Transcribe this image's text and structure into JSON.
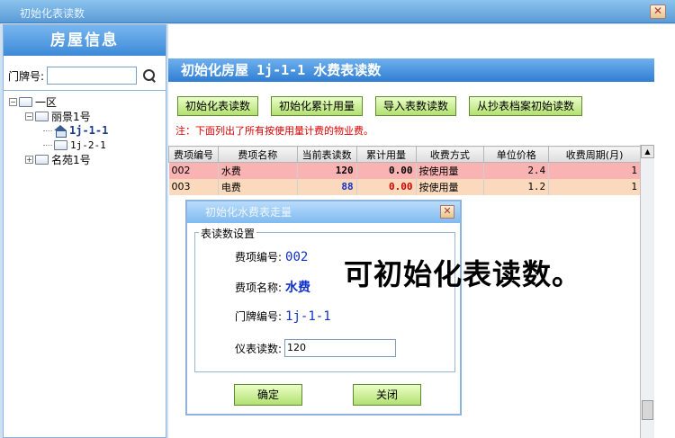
{
  "window": {
    "title": "初始化表读数",
    "close_label": "✕"
  },
  "left_panel": {
    "header": "房屋信息",
    "door_label": "门牌号:",
    "door_value": "",
    "tree": [
      {
        "label": "一区",
        "toggle": "−"
      },
      {
        "label": "丽景1号",
        "toggle": "−"
      },
      {
        "label": "1j-1-1"
      },
      {
        "label": "1j-2-1"
      },
      {
        "label": "名苑1号",
        "toggle": "+"
      }
    ]
  },
  "main": {
    "header": "初始化房屋 1j-1-1 水费表读数",
    "buttons": [
      "初始化表读数",
      "初始化累计用量",
      "导入表数读数",
      "从抄表档案初始读数"
    ],
    "note": "注：下面列出了所有按使用量计费的物业费。",
    "table": {
      "columns": [
        "费项编号",
        "费项名称",
        "当前表读数",
        "累计用量",
        "收费方式",
        "单位价格",
        "收费周期(月)"
      ],
      "rows": [
        {
          "code": "002",
          "name": "水费",
          "reading": "120",
          "usage": "0.00",
          "method": "按使用量",
          "price": "2.4",
          "cycle": "1"
        },
        {
          "code": "003",
          "name": "电费",
          "reading": "88",
          "usage": "0.00",
          "method": "按使用量",
          "price": "1.2",
          "cycle": "1"
        }
      ]
    }
  },
  "dialog": {
    "title": "初始化水费表走量",
    "close_label": "✕",
    "group_label": "表读数设置",
    "code_label": "费项编号:",
    "code_value": "002",
    "name_label": "费项名称:",
    "name_value": "水费",
    "door_label": "门牌编号:",
    "door_value": "1j-1-1",
    "reading_label": "仪表读数:",
    "reading_value": "120",
    "ok_label": "确定",
    "close_button_label": "关闭"
  },
  "overlay_text": "可初始化表读数。"
}
